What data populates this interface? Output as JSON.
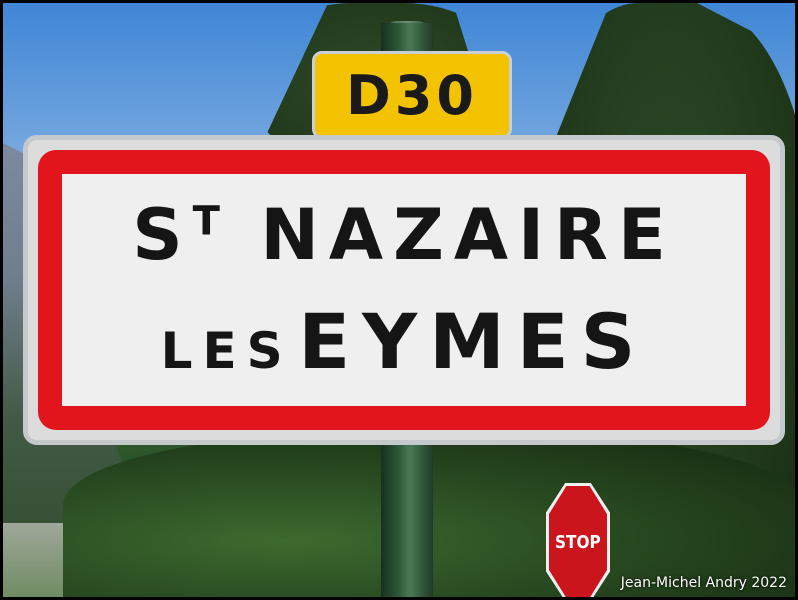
{
  "road_plate": {
    "number": "D30"
  },
  "town_sign": {
    "line1_prefix": "S",
    "line1_superscript": "T",
    "line1_name": "NAZAIRE",
    "line2_small": "LES",
    "line2_big": "EYMES"
  },
  "stop_sign": {
    "label": "STOP"
  },
  "credit": "Jean-Michel Andry 2022",
  "colors": {
    "sign_border": "#e2141c",
    "road_plate": "#f3c200",
    "stop_red": "#c9151b"
  }
}
